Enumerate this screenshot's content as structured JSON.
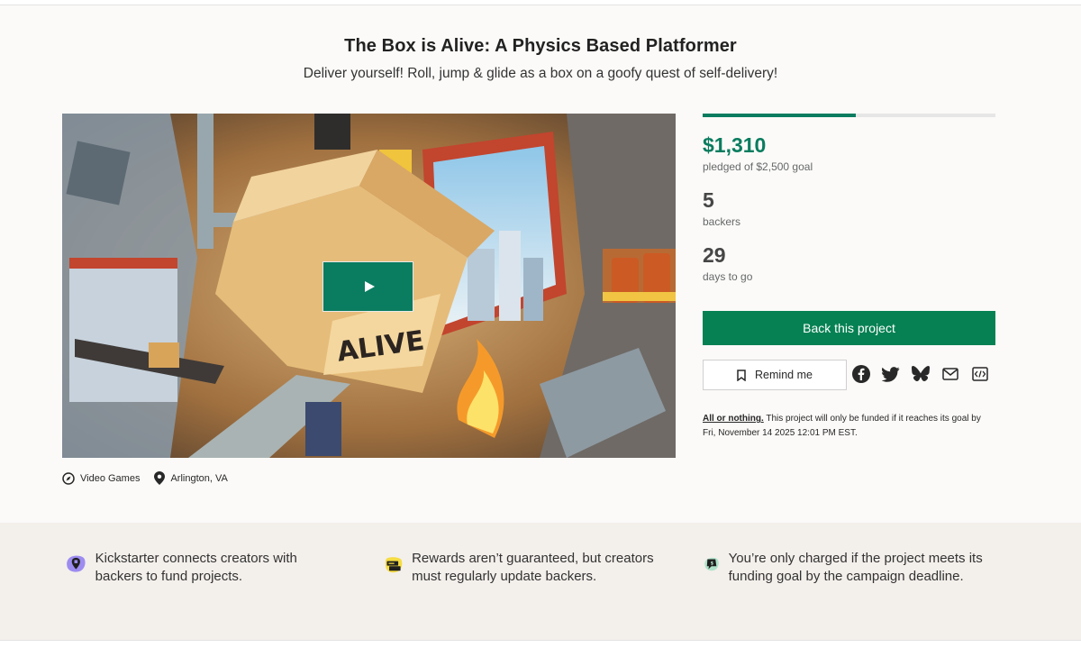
{
  "project": {
    "title": "The Box is Alive: A Physics Based Platformer",
    "subtitle": "Deliver yourself! Roll, jump & glide as a box on a goofy quest of self-delivery!"
  },
  "media": {
    "video_icon": "play-icon"
  },
  "meta": {
    "category": "Video Games",
    "category_icon": "compass-icon",
    "location": "Arlington, VA",
    "location_icon": "map-pin-icon"
  },
  "stats": {
    "progress_fraction": 0.524,
    "pledged": "$1,310",
    "pledged_label": "pledged of $2,500 goal",
    "backers": "5",
    "backers_label": "backers",
    "days": "29",
    "days_label": "days to go"
  },
  "actions": {
    "back_label": "Back this project",
    "remind_label": "Remind me",
    "share_icons": [
      "facebook-icon",
      "twitter-icon",
      "bluesky-icon",
      "email-icon",
      "embed-icon"
    ]
  },
  "funding_note": {
    "link": "All or nothing.",
    "text": " This project will only be funded if it reaches its goal by Fri, November 14 2025 12:01 PM EST."
  },
  "features": [
    {
      "icon": "location-pin-badge-icon",
      "text": "Kickstarter connects creators with backers to fund projects."
    },
    {
      "icon": "chat-bubbles-icon",
      "text": "Rewards aren’t guaranteed, but creators must regularly update backers."
    },
    {
      "icon": "money-bubble-icon",
      "text": "You’re only charged if the project meets its funding goal by the campaign deadline."
    }
  ],
  "colors": {
    "accent": "#0a7c5f",
    "button": "#058153",
    "band": "#f3efeb"
  }
}
